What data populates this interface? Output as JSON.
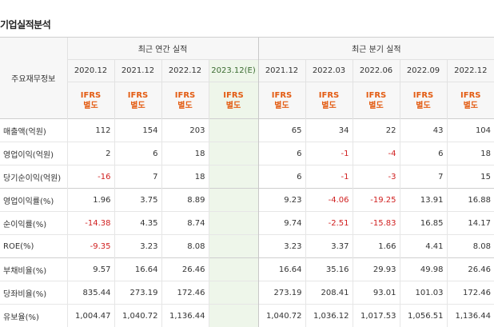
{
  "section_title": "기업실적분석",
  "table": {
    "row_header_label": "주요재무정보",
    "group_annual": "최근 연간 실적",
    "group_quarterly": "최근 분기 실적",
    "periods_annual": [
      "2020.12",
      "2021.12",
      "2022.12",
      "2023.12(E)"
    ],
    "periods_quarterly": [
      "2021.12",
      "2022.03",
      "2022.06",
      "2022.09",
      "2022.12"
    ],
    "basis_line1": "IFRS",
    "basis_line2": "별도",
    "rows": [
      {
        "label": "매출액(억원)",
        "annual": [
          "112",
          "154",
          "203",
          ""
        ],
        "quarterly": [
          "65",
          "34",
          "22",
          "43",
          "104"
        ]
      },
      {
        "label": "영업이익(억원)",
        "annual": [
          "2",
          "6",
          "18",
          ""
        ],
        "quarterly": [
          "6",
          "-1",
          "-4",
          "6",
          "18"
        ]
      },
      {
        "label": "당기순이익(억원)",
        "annual": [
          "-16",
          "7",
          "18",
          ""
        ],
        "quarterly": [
          "6",
          "-1",
          "-3",
          "7",
          "15"
        ]
      },
      {
        "label": "영업이익률(%)",
        "annual": [
          "1.96",
          "3.75",
          "8.89",
          ""
        ],
        "quarterly": [
          "9.23",
          "-4.06",
          "-19.25",
          "13.91",
          "16.88"
        ]
      },
      {
        "label": "순이익률(%)",
        "annual": [
          "-14.38",
          "4.35",
          "8.74",
          ""
        ],
        "quarterly": [
          "9.74",
          "-2.51",
          "-15.83",
          "16.85",
          "14.17"
        ]
      },
      {
        "label": "ROE(%)",
        "annual": [
          "-9.35",
          "3.23",
          "8.08",
          ""
        ],
        "quarterly": [
          "3.23",
          "3.37",
          "1.66",
          "4.41",
          "8.08"
        ]
      },
      {
        "label": "부채비율(%)",
        "annual": [
          "9.57",
          "16.64",
          "26.46",
          ""
        ],
        "quarterly": [
          "16.64",
          "35.16",
          "29.93",
          "49.98",
          "26.46"
        ]
      },
      {
        "label": "당좌비율(%)",
        "annual": [
          "835.44",
          "273.19",
          "172.46",
          ""
        ],
        "quarterly": [
          "273.19",
          "208.41",
          "93.01",
          "101.03",
          "172.46"
        ]
      },
      {
        "label": "유보율(%)",
        "annual": [
          "1,004.47",
          "1,040.72",
          "1,136.44",
          ""
        ],
        "quarterly": [
          "1,040.72",
          "1,036.12",
          "1,017.53",
          "1,056.51",
          "1,136.44"
        ]
      }
    ]
  },
  "colors": {
    "accent_orange": "#e35c13",
    "negative_red": "#d01f1f",
    "estimate_bg": "#eef6ea"
  }
}
